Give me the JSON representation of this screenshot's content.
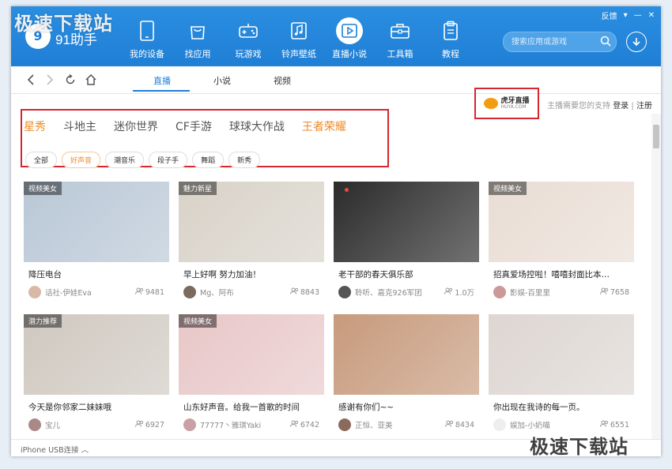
{
  "app": {
    "name": "91助手",
    "logo_text": "9"
  },
  "window_controls": {
    "feedback": "反馈"
  },
  "nav": [
    {
      "label": "我的设备",
      "icon": "phone-icon"
    },
    {
      "label": "找应用",
      "icon": "bag-icon"
    },
    {
      "label": "玩游戏",
      "icon": "gamepad-icon"
    },
    {
      "label": "铃声壁纸",
      "icon": "music-icon"
    },
    {
      "label": "直播小说",
      "icon": "play-icon",
      "active": true
    },
    {
      "label": "工具箱",
      "icon": "toolbox-icon"
    },
    {
      "label": "教程",
      "icon": "clipboard-icon"
    }
  ],
  "search": {
    "placeholder": "搜索应用或游戏"
  },
  "subtabs": [
    "直播",
    "小说",
    "视频"
  ],
  "huya": {
    "text": "虎牙直播",
    "sub": "HUYA.COM"
  },
  "support": {
    "text": "主播需要您的支持",
    "login": "登录",
    "sep": "|",
    "register": "注册"
  },
  "categories": [
    "星秀",
    "斗地主",
    "迷你世界",
    "CF手游",
    "球球大作战",
    "王者荣耀"
  ],
  "tags": [
    "全部",
    "好声音",
    "潮音乐",
    "段子手",
    "舞蹈",
    "新秀"
  ],
  "cards": [
    {
      "badge": "视频美女",
      "title": "降压电台",
      "user": "话社-伊娃Eva",
      "count": "9481",
      "thumb": "#b9c7d6",
      "avatar": "#d9b8a8"
    },
    {
      "badge": "魅力新星",
      "title": "早上好啊 努力加油！",
      "user": "Mg、阿布",
      "count": "8843",
      "thumb": "#d8d2c8",
      "avatar": "#7b6a5d"
    },
    {
      "badge": "",
      "title": "老干部的春天俱乐部",
      "user": "聆听、嘉克926军团",
      "count": "1.0万",
      "thumb": "#2b2b2b",
      "avatar": "#555"
    },
    {
      "badge": "视频美女",
      "title": "招真爱场控啦！嘻嘻封面比本…",
      "user": "影娱-百里里",
      "count": "7658",
      "thumb": "#e9ddd4",
      "avatar": "#c99"
    },
    {
      "badge": "潜力推荐",
      "title": "今天是你邻家二妹妹哦",
      "user": "宝儿",
      "count": "6927",
      "thumb": "#cfc8c0",
      "avatar": "#a88"
    },
    {
      "badge": "视频美女",
      "title": "山东好声音。给我一首歌的时间",
      "user": "77777丶雅琪Yaki",
      "count": "6742",
      "thumb": "#e8c7c8",
      "avatar": "#c8a0a5"
    },
    {
      "badge": "",
      "title": "感谢有你们~~",
      "user": "正恒、亚美",
      "count": "8434",
      "thumb": "#c79a7c",
      "avatar": "#8a6b5b"
    },
    {
      "badge": "",
      "title": "你出现在我诗的每一页。",
      "user": "娱加-小奶喵",
      "count": "6551",
      "thumb": "#ddd6d2",
      "avatar": "#eee"
    }
  ],
  "status": {
    "text": "iPhone  USB连接 ︿"
  },
  "watermark": {
    "text": "极速下载站"
  },
  "colors": {
    "accent": "#1f7fd6",
    "orange": "#f08a24",
    "highlight": "#d6262e"
  }
}
